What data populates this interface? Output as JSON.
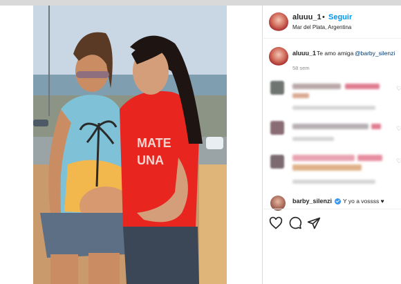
{
  "post": {
    "username": "aluuu_1",
    "separator": "•",
    "follow_label": "Seguir",
    "location": "Mar del Plata, Argentina"
  },
  "caption": {
    "username": "aluuu_1",
    "text": "Te amo amiga",
    "mention": "@barby_silenzi",
    "time": "58 sem"
  },
  "reply": {
    "username": "barby_silenzi",
    "text": "Y yo a vossss ♥"
  },
  "actions": {
    "like_icon": "heart-outline-icon",
    "comment_icon": "comment-bubble-icon",
    "share_icon": "paper-plane-icon"
  },
  "colors": {
    "link_blue": "#0095f6",
    "mention_blue": "#00376b",
    "text": "#262626",
    "muted": "#8e8e8e",
    "shirt_red": "#e8261f"
  }
}
